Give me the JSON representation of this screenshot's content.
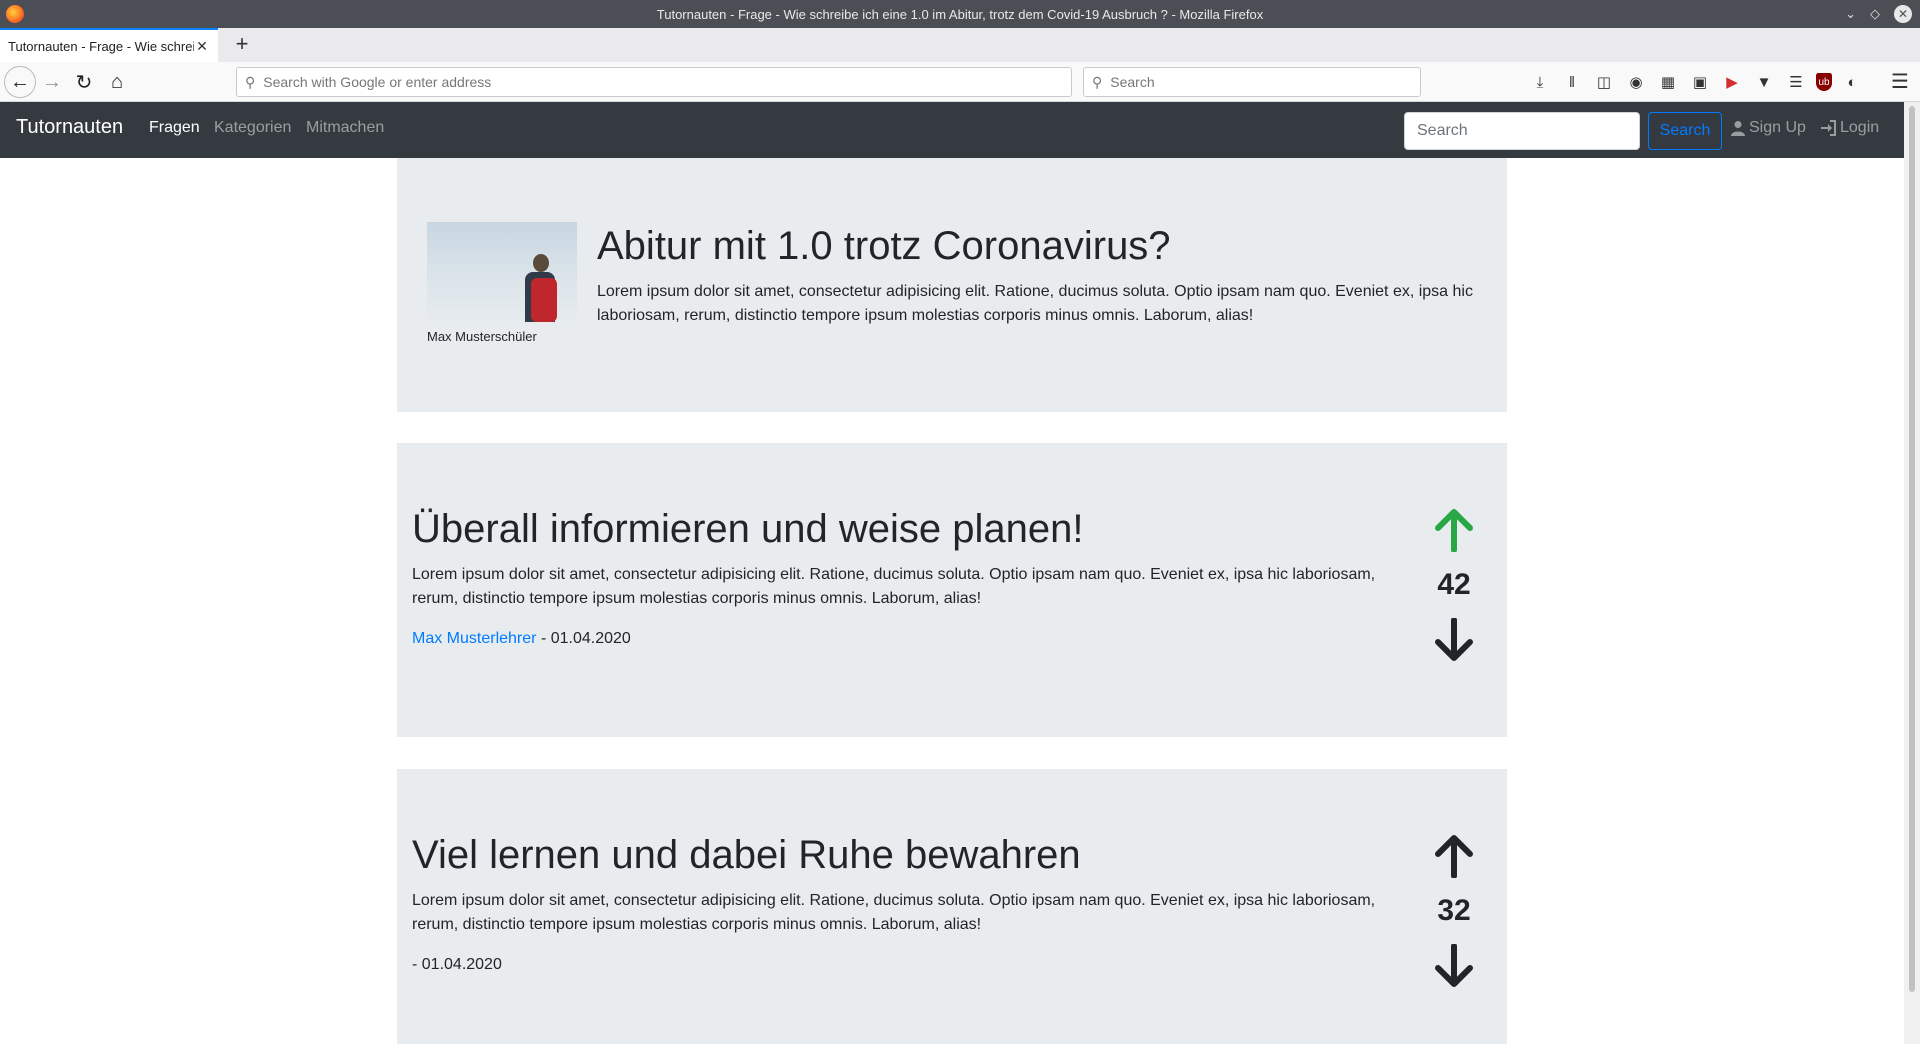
{
  "window": {
    "title": "Tutornauten - Frage - Wie schreibe ich eine 1.0 im Abitur, trotz dem Covid-19 Ausbruch ? - Mozilla Firefox"
  },
  "browser": {
    "tab_title": "Tutornauten - Frage - Wie schreibe ich eine 1.0 im Abitur, trotz dem Covid-19 Ausbruch ?",
    "url_placeholder": "Search with Google or enter address",
    "search_placeholder": "Search"
  },
  "site": {
    "brand": "Tutornauten",
    "nav": [
      "Fragen",
      "Kategorien",
      "Mitmachen"
    ],
    "search_placeholder": "Search",
    "search_button": "Search",
    "signup": "Sign Up",
    "login": "Login"
  },
  "question": {
    "title": "Abitur mit 1.0 trotz Coronavirus?",
    "body": "Lorem ipsum dolor sit amet, consectetur adipisicing elit. Ratione, ducimus soluta. Optio ipsam nam quo. Eveniet ex, ipsa hic laboriosam, rerum, distinctio tempore ipsum molestias corporis minus omnis. Laborum, alias!",
    "author": "Max Musterschüler"
  },
  "answers": [
    {
      "title": "Überall informieren und weise planen!",
      "body": "Lorem ipsum dolor sit amet, consectetur adipisicing elit. Ratione, ducimus soluta. Optio ipsam nam quo. Eveniet ex, ipsa hic laboriosam, rerum, distinctio tempore ipsum molestias corporis minus omnis. Laborum, alias!",
      "author": "Max Musterlehrer",
      "date": "- 01.04.2020",
      "votes": "42",
      "upvoted": true
    },
    {
      "title": "Viel lernen und dabei Ruhe bewahren",
      "body": "Lorem ipsum dolor sit amet, consectetur adipisicing elit. Ratione, ducimus soluta. Optio ipsam nam quo. Eveniet ex, ipsa hic laboriosam, rerum, distinctio tempore ipsum molestias corporis minus omnis. Laborum, alias!",
      "author": "",
      "date": "- 01.04.2020",
      "votes": "32",
      "upvoted": false
    }
  ],
  "colors": {
    "upvote_active": "#28a745",
    "vote_default": "#212529",
    "link": "#007bff"
  }
}
